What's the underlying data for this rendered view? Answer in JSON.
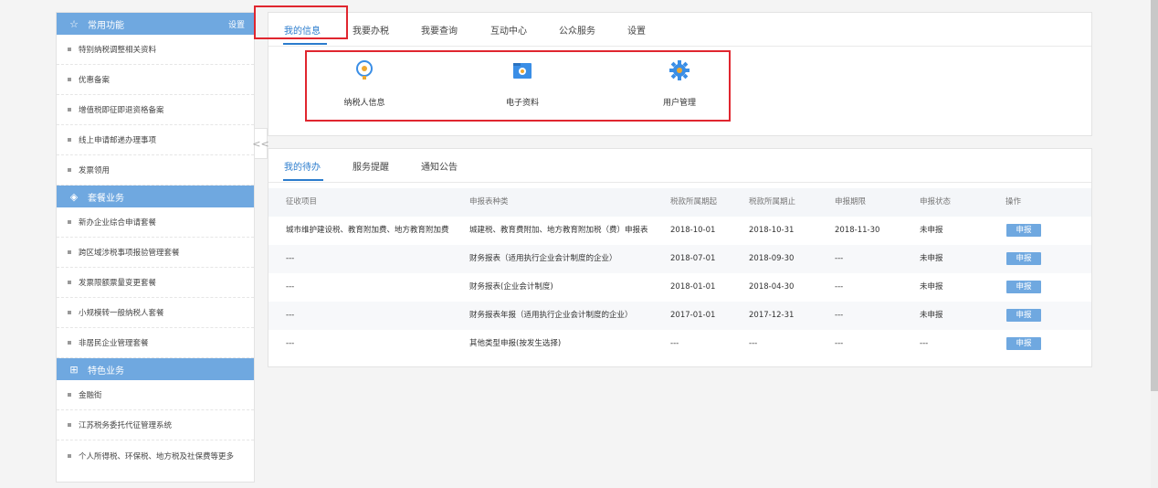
{
  "sidebar": {
    "sections": [
      {
        "title": "常用功能",
        "icon": "star-icon",
        "action": "设置",
        "items": [
          "特别纳税调整相关资料",
          "优惠备案",
          "增值税即征即退资格备案",
          "线上申请邮递办理事项",
          "发票领用"
        ]
      },
      {
        "title": "套餐业务",
        "icon": "layers-icon",
        "items": [
          "新办企业综合申请套餐",
          "跨区域涉税事项报验管理套餐",
          "发票限额票量变更套餐",
          "小规模转一般纳税人套餐",
          "非居民企业管理套餐"
        ]
      },
      {
        "title": "特色业务",
        "icon": "grid-icon",
        "items": [
          "金融街",
          "江苏税务委托代征管理系统",
          "个人所得税、环保税、地方税及社保费等更多"
        ]
      }
    ],
    "collapse_glyph": "<<"
  },
  "top_nav": {
    "tabs": [
      "我的信息",
      "我要办税",
      "我要查询",
      "互动中心",
      "公众服务",
      "设置"
    ]
  },
  "features": [
    {
      "label": "纳税人信息",
      "icon": "taxpayer-info-icon"
    },
    {
      "label": "电子资料",
      "icon": "electronic-folder-icon"
    },
    {
      "label": "用户管理",
      "icon": "user-gear-icon"
    }
  ],
  "sub_tabs": [
    "我的待办",
    "服务提醒",
    "通知公告"
  ],
  "table": {
    "headers": [
      "征收项目",
      "申报表种类",
      "税款所属期起",
      "税款所属期止",
      "申报期限",
      "申报状态",
      "操作"
    ],
    "rows": [
      [
        "城市维护建设税、教育附加费、地方教育附加费",
        "城建税、教育费附加、地方教育附加税（费）申报表",
        "2018-10-01",
        "2018-10-31",
        "2018-11-30",
        "未申报",
        "申报"
      ],
      [
        "---",
        "财务报表（适用执行企业会计制度的企业）",
        "2018-07-01",
        "2018-09-30",
        "---",
        "未申报",
        "申报"
      ],
      [
        "---",
        "财务报表(企业会计制度)",
        "2018-01-01",
        "2018-04-30",
        "---",
        "未申报",
        "申报"
      ],
      [
        "---",
        "财务报表年报（适用执行企业会计制度的企业）",
        "2017-01-01",
        "2017-12-31",
        "---",
        "未申报",
        "申报"
      ],
      [
        "---",
        "其他类型申报(按发生选择)",
        "---",
        "---",
        "---",
        "---",
        "申报"
      ]
    ]
  },
  "colors": {
    "accent": "#2b7ccd",
    "section_header": "#6fa8e0",
    "highlight": "#e0262f"
  }
}
